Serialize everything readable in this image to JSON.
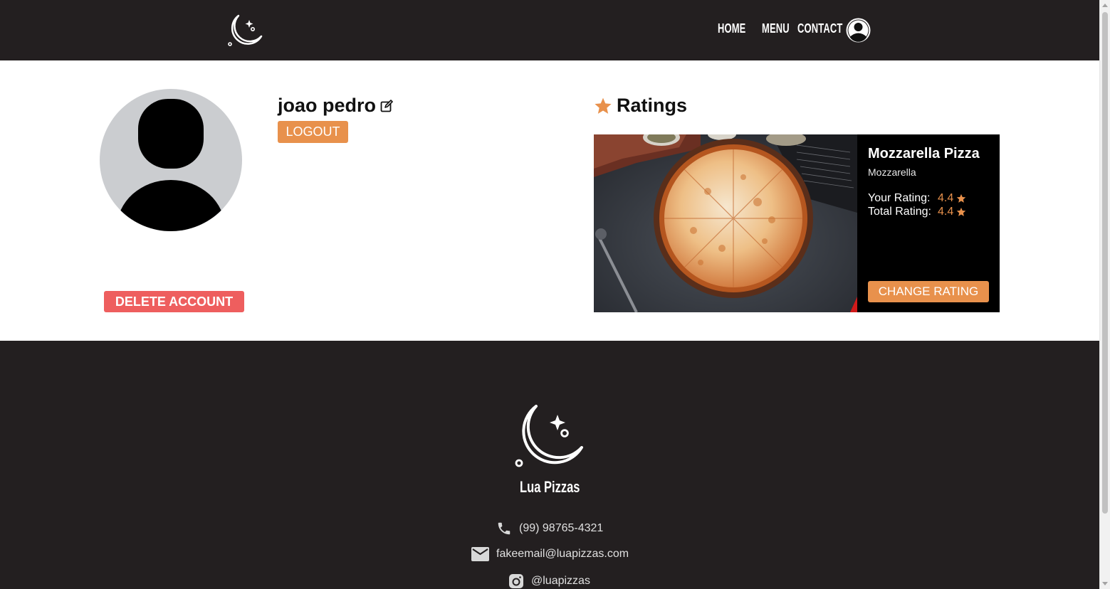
{
  "header": {
    "nav": {
      "home": "HOME",
      "menu": "MENU",
      "contact": "CONTACT"
    }
  },
  "profile": {
    "username": "joao pedro",
    "logout_label": "LOGOUT",
    "delete_label": "DELETE ACCOUNT"
  },
  "ratings": {
    "title": "Ratings",
    "items": [
      {
        "name": "Mozzarella Pizza",
        "subtitle": "Mozzarella",
        "your_rating_label": "Your Rating:",
        "your_rating": "4.4",
        "total_rating_label": "Total Rating:",
        "total_rating": "4.4",
        "change_label": "CHANGE RATING"
      }
    ]
  },
  "footer": {
    "brand": "Lua Pizzas",
    "phone": "(99) 98765-4321",
    "email": "fakeemail@luapizzas.com",
    "instagram": "@luapizzas"
  },
  "colors": {
    "dark": "#231f20",
    "accent": "#e8914c",
    "danger": "#ee5e5e"
  },
  "icons": [
    "moon-logo-icon",
    "user-account-icon",
    "edit-icon",
    "star-icon",
    "phone-icon",
    "email-icon",
    "instagram-icon"
  ]
}
